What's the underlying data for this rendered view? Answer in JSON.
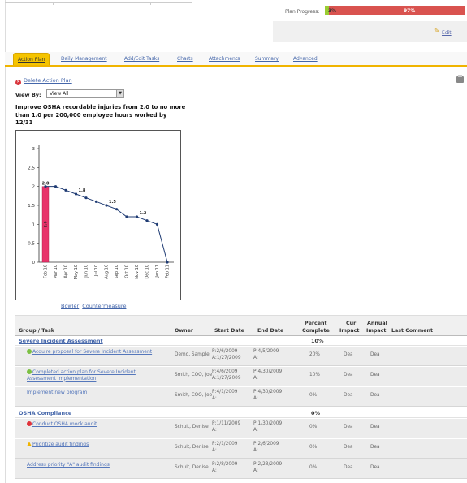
{
  "header": {
    "plan_progress_label": "Plan Progress:",
    "progress_done": "3%",
    "progress_remaining": "97%",
    "progress_fraction": 0.03,
    "edit_label": "Edit"
  },
  "tabs": [
    {
      "label": "Action Plan",
      "active": true
    },
    {
      "label": "Daily Management"
    },
    {
      "label": "Add/Edit Tasks"
    },
    {
      "label": "Charts"
    },
    {
      "label": "Attachments"
    },
    {
      "label": "Summary"
    },
    {
      "label": "Advanced"
    }
  ],
  "actions": {
    "delete_plan": "Delete Action Plan"
  },
  "view_by": {
    "label": "View By:",
    "selected": "View All"
  },
  "goal_text": "Improve OSHA recordable injuries from 2.0 to no more than 1.0 per 200,000 employee hours worked by 12/31",
  "chart_links": {
    "bowler": "Bowler",
    "countermeasure": "Countermeasure"
  },
  "chart_data": {
    "type": "line",
    "title": "",
    "xlabel": "",
    "ylabel": "",
    "ylim": [
      0,
      3
    ],
    "yticks": [
      "0",
      "0.5",
      "1",
      "1.5",
      "2",
      "2.5",
      "3"
    ],
    "categories": [
      "Feb 10",
      "Mar 10",
      "Apr 10",
      "May 10",
      "Jun 10",
      "Jul 10",
      "Aug 10",
      "Sep 10",
      "Oct 10",
      "Nov 10",
      "Dec 10",
      "Jan 11",
      "Feb 11"
    ],
    "bar": {
      "category": "Feb 10",
      "value": 2.0,
      "label": "2.0",
      "inner_label": "2.0",
      "color": "#e8336b"
    },
    "series": [
      {
        "values": [
          2.0,
          2.0,
          1.9,
          1.8,
          1.7,
          1.6,
          1.5,
          1.4,
          1.2,
          1.2,
          1.1,
          1.0,
          0.0
        ],
        "color": "#1f3b73"
      }
    ],
    "point_labels": [
      {
        "index": 3,
        "text": "1.8"
      },
      {
        "index": 6,
        "text": "1.5"
      },
      {
        "index": 9,
        "text": "1.2"
      }
    ],
    "grid": false
  },
  "table": {
    "headers": {
      "group_task": "Group / Task",
      "owner": "Owner",
      "start_date": "Start Date",
      "end_date": "End Date",
      "percent_complete_1": "Percent",
      "percent_complete_2": "Complete",
      "cur_impact_1": "Cur",
      "cur_impact_2": "Impact",
      "annual_impact_1": "Annual",
      "annual_impact_2": "Impact",
      "last_comment": "Last Comment"
    },
    "groups": [
      {
        "name": "Severe Incident Assessment",
        "percent": "10%",
        "tasks": [
          {
            "name": "Acquire proposal for Severe Incident Assessment",
            "status": "green",
            "owner": "Demo, Sample",
            "start_p": "P:2/6/2009",
            "start_a": "A:1/27/2009",
            "end_p": "P:4/5/2009",
            "end_a": "A:",
            "percent": "20%",
            "cur": "Dea",
            "annual": "Dea"
          },
          {
            "name": "Completed action plan for Severe Incident Assessment implementation",
            "status": "green",
            "owner": "Smith, COO, Joe",
            "start_p": "P:4/6/2009",
            "start_a": "A:1/27/2009",
            "end_p": "P:4/30/2009",
            "end_a": "A:",
            "percent": "10%",
            "cur": "Dea",
            "annual": "Dea"
          },
          {
            "name": "Implement new program",
            "status": "",
            "owner": "Smith, COO, Joe",
            "start_p": "P:4/1/2009",
            "start_a": "A:",
            "end_p": "P:4/30/2009",
            "end_a": "A:",
            "percent": "0%",
            "cur": "Dea",
            "annual": "Dea"
          }
        ]
      },
      {
        "name": "OSHA Compliance",
        "percent": "0%",
        "tasks": [
          {
            "name": "Conduct OSHA mock audit",
            "status": "red",
            "owner": "Schult, Denise",
            "start_p": "P:1/11/2009",
            "start_a": "A:",
            "end_p": "P:1/30/2009",
            "end_a": "A:",
            "percent": "0%",
            "cur": "Dea",
            "annual": "Dea"
          },
          {
            "name": "Prioritize audit findings",
            "status": "yellow",
            "owner": "Schult, Denise",
            "start_p": "P:2/1/2009",
            "start_a": "A:",
            "end_p": "P:2/6/2009",
            "end_a": "A:",
            "percent": "0%",
            "cur": "Dea",
            "annual": "Dea"
          },
          {
            "name": "Address priority \"A\" audit findings",
            "status": "",
            "owner": "Schult, Denise",
            "start_p": "P:2/8/2009",
            "start_a": "A:",
            "end_p": "P:2/28/2009",
            "end_a": "A:",
            "percent": "0%",
            "cur": "Dea",
            "annual": "Dea"
          }
        ]
      }
    ]
  }
}
